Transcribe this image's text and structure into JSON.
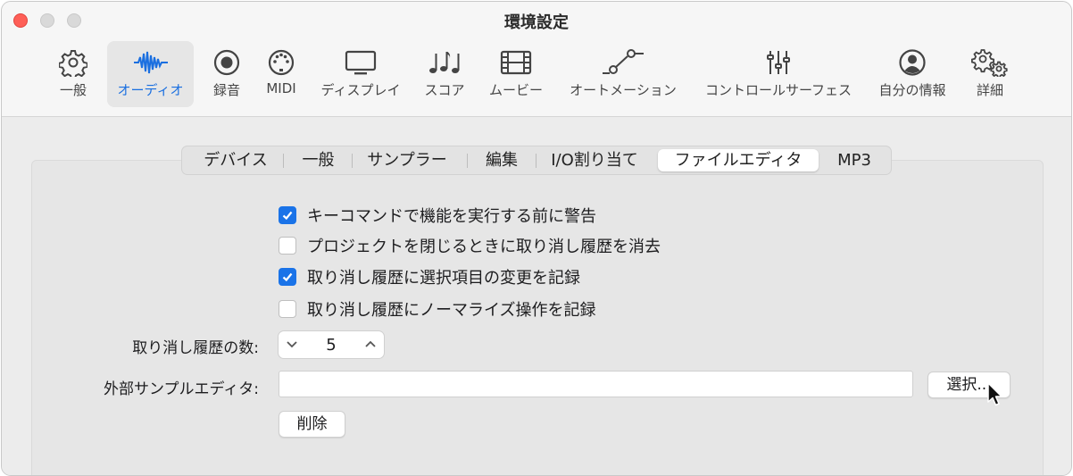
{
  "window": {
    "title": "環境設定"
  },
  "toolbar": {
    "items": [
      {
        "label": "一般",
        "icon": "gear-icon"
      },
      {
        "label": "オーディオ",
        "icon": "waveform-icon"
      },
      {
        "label": "録音",
        "icon": "record-icon"
      },
      {
        "label": "MIDI",
        "icon": "midi-port-icon"
      },
      {
        "label": "ディスプレイ",
        "icon": "display-icon"
      },
      {
        "label": "スコア",
        "icon": "music-notes-icon"
      },
      {
        "label": "ムービー",
        "icon": "film-icon"
      },
      {
        "label": "オートメーション",
        "icon": "automation-curve-icon"
      },
      {
        "label": "コントロールサーフェス",
        "icon": "faders-icon"
      },
      {
        "label": "自分の情報",
        "icon": "person-circle-icon"
      },
      {
        "label": "詳細",
        "icon": "gears-icon"
      }
    ],
    "active_index": 1
  },
  "tabs": {
    "items": [
      "デバイス",
      "一般",
      "サンプラー",
      "編集",
      "I/O割り当て",
      "ファイルエディタ",
      "MP3"
    ],
    "selected_index": 5
  },
  "options": [
    {
      "label": "キーコマンドで機能を実行する前に警告",
      "checked": true
    },
    {
      "label": "プロジェクトを閉じるときに取り消し履歴を消去",
      "checked": false
    },
    {
      "label": "取り消し履歴に選択項目の変更を記録",
      "checked": true
    },
    {
      "label": "取り消し履歴にノーマライズ操作を記録",
      "checked": false
    }
  ],
  "undo_steps": {
    "label": "取り消し履歴の数:",
    "value": "5"
  },
  "external_editor": {
    "label": "外部サンプルエディタ:",
    "value": "",
    "choose_label": "選択...",
    "delete_label": "削除"
  },
  "colors": {
    "accent": "#1a73e8",
    "close": "#fe5f57"
  }
}
